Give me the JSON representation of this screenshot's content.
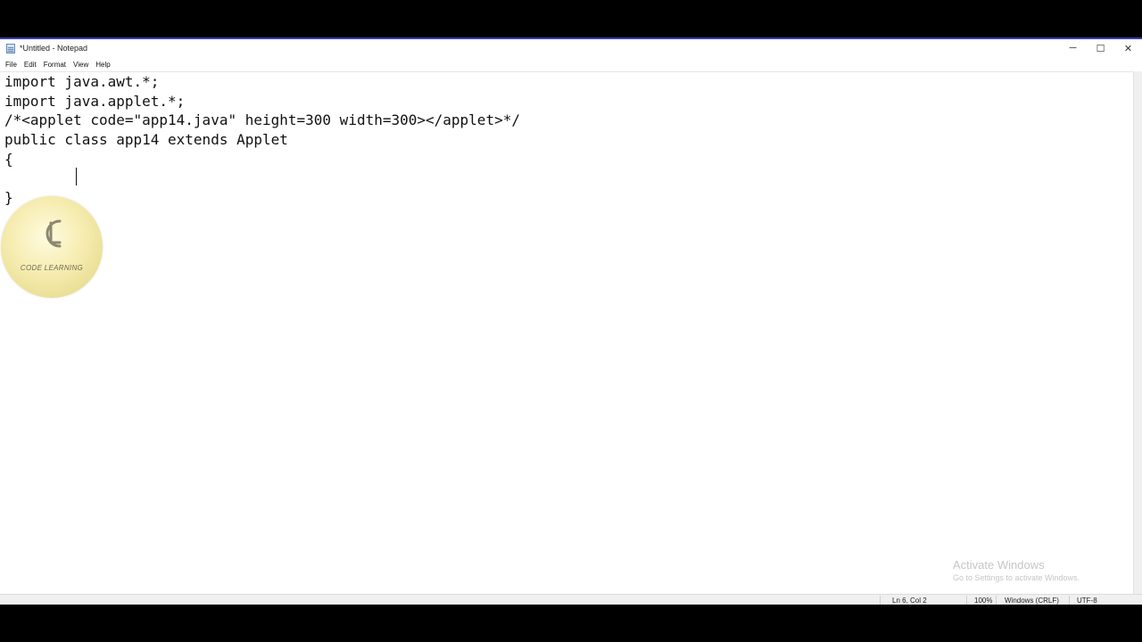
{
  "window": {
    "title": "*Untitled - Notepad",
    "controls": {
      "minimize": "─",
      "maximize": "☐",
      "close": "✕"
    }
  },
  "menu": [
    "File",
    "Edit",
    "Format",
    "View",
    "Help"
  ],
  "editor": {
    "lines": [
      "import java.awt.*;",
      "import java.applet.*;",
      "/*<applet code=\"app14.java\" height=300 width=300></applet>*/",
      "public class app14 extends Applet",
      "{",
      "",
      "}"
    ]
  },
  "overlay_logo": {
    "text": "CODE LEARNING",
    "accent": "#e9df9a"
  },
  "watermark": {
    "title": "Activate Windows",
    "subtitle": "Go to Settings to activate Windows."
  },
  "status": {
    "position": "Ln 6, Col 2",
    "zoom": "100%",
    "line_ending": "Windows (CRLF)",
    "encoding": "UTF-8"
  },
  "colors": {
    "title_accent": "#3b3bb0"
  }
}
